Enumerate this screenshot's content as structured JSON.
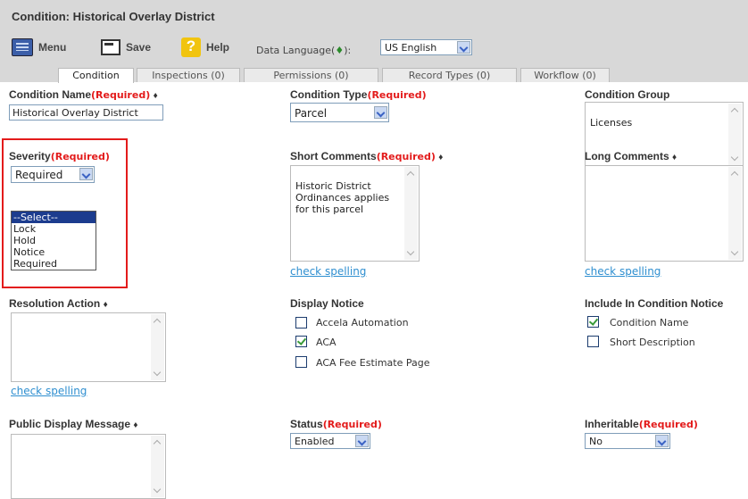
{
  "window": {
    "title": "Condition: Historical Overlay District"
  },
  "toolbar": {
    "menu_label": "Menu",
    "save_label": "Save",
    "help_label": "Help",
    "language_label": "Data Language(",
    "language_label_tail": "):",
    "language_value": "US English"
  },
  "tabs": [
    {
      "label": "Condition"
    },
    {
      "label": "Inspections (0)"
    },
    {
      "label": "Permissions (0)"
    },
    {
      "label": "Record Types (0)"
    },
    {
      "label": "Workflow (0)"
    }
  ],
  "form": {
    "required_marker": "(Required)",
    "condition_name": {
      "label": "Condition Name",
      "value": "Historical Overlay District"
    },
    "condition_type": {
      "label": "Condition Type",
      "value": "Parcel"
    },
    "condition_group": {
      "label": "Condition Group",
      "value": "Licenses"
    },
    "severity": {
      "label": "Severity",
      "value": "Required",
      "options": [
        "--Select--",
        "Lock",
        "Hold",
        "Notice",
        "Required"
      ]
    },
    "short_comments": {
      "label": "Short Comments",
      "value": "Historic District\nOrdinances applies\nfor this parcel",
      "spell": "check spelling"
    },
    "long_comments": {
      "label": "Long Comments",
      "value": "",
      "spell": "check spelling"
    },
    "resolution_action": {
      "label": "Resolution Action",
      "value": "",
      "spell": "check spelling"
    },
    "display_notice": {
      "label": "Display Notice",
      "options": [
        {
          "label": "Accela Automation",
          "checked": false
        },
        {
          "label": "ACA",
          "checked": true
        },
        {
          "label": "ACA Fee Estimate Page",
          "checked": false
        }
      ]
    },
    "include_in_notice": {
      "label": "Include In Condition Notice",
      "options": [
        {
          "label": "Condition Name",
          "checked": true
        },
        {
          "label": "Short Description",
          "checked": false
        }
      ]
    },
    "public_display_message": {
      "label": "Public Display Message",
      "value": ""
    },
    "status": {
      "label": "Status",
      "value": "Enabled"
    },
    "inheritable": {
      "label": "Inheritable",
      "value": "No"
    }
  }
}
